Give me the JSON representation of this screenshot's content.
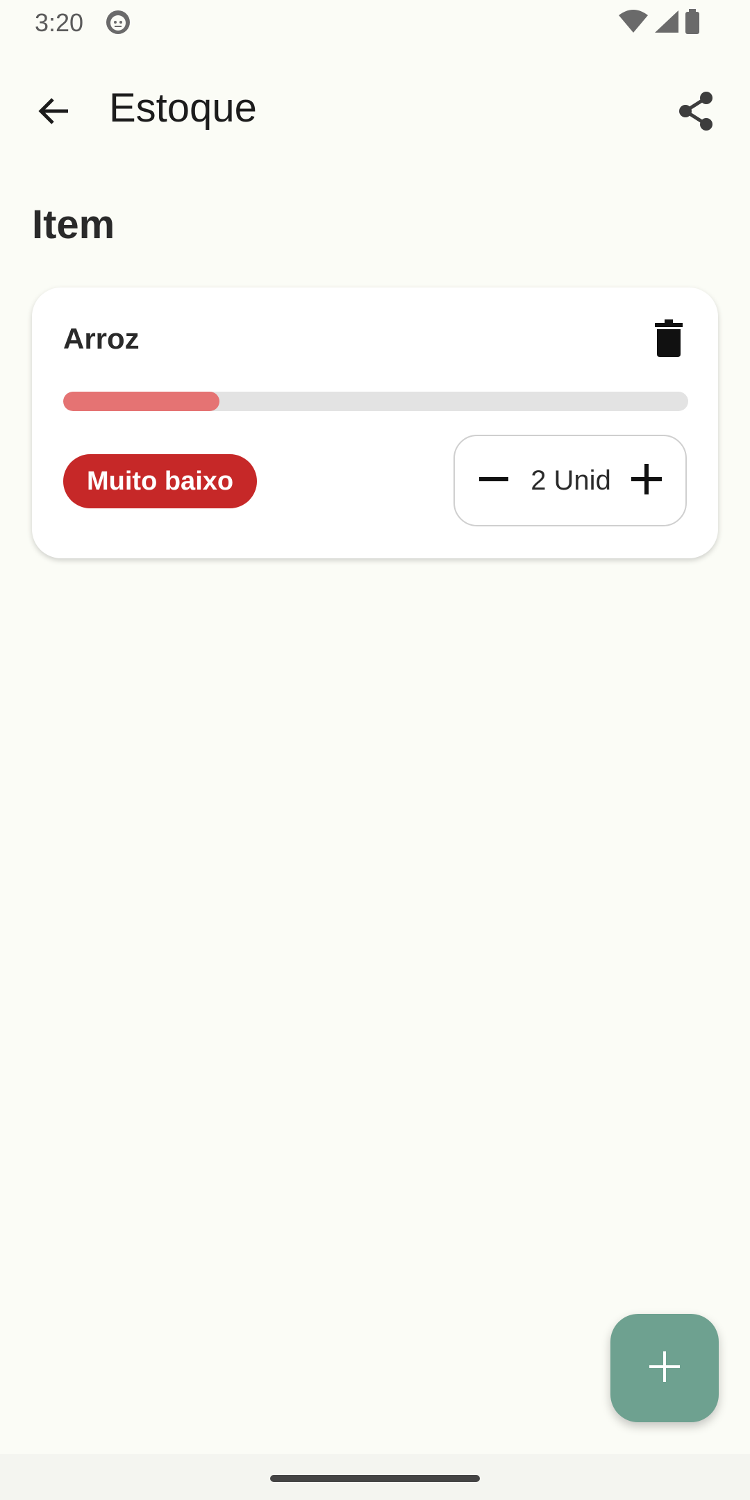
{
  "status_bar": {
    "time": "3:20",
    "icons": [
      "app-notification-icon",
      "wifi-icon",
      "signal-icon",
      "battery-icon"
    ]
  },
  "app_bar": {
    "title": "Estoque",
    "back_icon": "arrow-back-icon",
    "share_icon": "share-icon"
  },
  "section": {
    "title": "Item"
  },
  "items": [
    {
      "name": "Arroz",
      "status_label": "Muito baixo",
      "quantity_text": "2 Unid",
      "level_fraction": 0.25,
      "delete_icon": "trash-icon",
      "decrement_icon": "minus-icon",
      "increment_icon": "plus-icon"
    }
  ],
  "fab": {
    "icon": "plus-icon"
  },
  "colors": {
    "background": "#fbfcf6",
    "progress_fill": "#e57373",
    "progress_track": "#e3e3e3",
    "status_badge": "#c62828",
    "fab": "#6ea190"
  }
}
